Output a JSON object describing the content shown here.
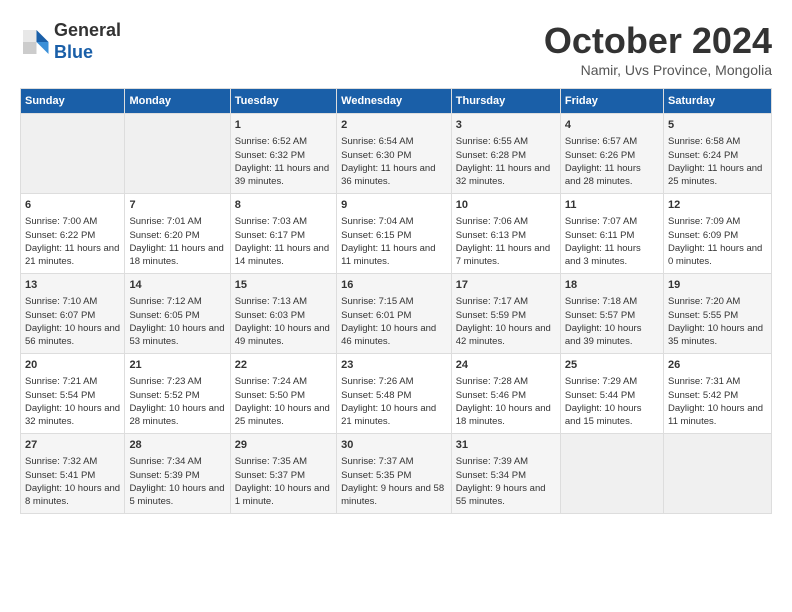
{
  "header": {
    "logo_line1": "General",
    "logo_line2": "Blue",
    "month_title": "October 2024",
    "location": "Namir, Uvs Province, Mongolia"
  },
  "weekdays": [
    "Sunday",
    "Monday",
    "Tuesday",
    "Wednesday",
    "Thursday",
    "Friday",
    "Saturday"
  ],
  "weeks": [
    [
      {
        "day": "",
        "info": ""
      },
      {
        "day": "",
        "info": ""
      },
      {
        "day": "1",
        "info": "Sunrise: 6:52 AM\nSunset: 6:32 PM\nDaylight: 11 hours and 39 minutes."
      },
      {
        "day": "2",
        "info": "Sunrise: 6:54 AM\nSunset: 6:30 PM\nDaylight: 11 hours and 36 minutes."
      },
      {
        "day": "3",
        "info": "Sunrise: 6:55 AM\nSunset: 6:28 PM\nDaylight: 11 hours and 32 minutes."
      },
      {
        "day": "4",
        "info": "Sunrise: 6:57 AM\nSunset: 6:26 PM\nDaylight: 11 hours and 28 minutes."
      },
      {
        "day": "5",
        "info": "Sunrise: 6:58 AM\nSunset: 6:24 PM\nDaylight: 11 hours and 25 minutes."
      }
    ],
    [
      {
        "day": "6",
        "info": "Sunrise: 7:00 AM\nSunset: 6:22 PM\nDaylight: 11 hours and 21 minutes."
      },
      {
        "day": "7",
        "info": "Sunrise: 7:01 AM\nSunset: 6:20 PM\nDaylight: 11 hours and 18 minutes."
      },
      {
        "day": "8",
        "info": "Sunrise: 7:03 AM\nSunset: 6:17 PM\nDaylight: 11 hours and 14 minutes."
      },
      {
        "day": "9",
        "info": "Sunrise: 7:04 AM\nSunset: 6:15 PM\nDaylight: 11 hours and 11 minutes."
      },
      {
        "day": "10",
        "info": "Sunrise: 7:06 AM\nSunset: 6:13 PM\nDaylight: 11 hours and 7 minutes."
      },
      {
        "day": "11",
        "info": "Sunrise: 7:07 AM\nSunset: 6:11 PM\nDaylight: 11 hours and 3 minutes."
      },
      {
        "day": "12",
        "info": "Sunrise: 7:09 AM\nSunset: 6:09 PM\nDaylight: 11 hours and 0 minutes."
      }
    ],
    [
      {
        "day": "13",
        "info": "Sunrise: 7:10 AM\nSunset: 6:07 PM\nDaylight: 10 hours and 56 minutes."
      },
      {
        "day": "14",
        "info": "Sunrise: 7:12 AM\nSunset: 6:05 PM\nDaylight: 10 hours and 53 minutes."
      },
      {
        "day": "15",
        "info": "Sunrise: 7:13 AM\nSunset: 6:03 PM\nDaylight: 10 hours and 49 minutes."
      },
      {
        "day": "16",
        "info": "Sunrise: 7:15 AM\nSunset: 6:01 PM\nDaylight: 10 hours and 46 minutes."
      },
      {
        "day": "17",
        "info": "Sunrise: 7:17 AM\nSunset: 5:59 PM\nDaylight: 10 hours and 42 minutes."
      },
      {
        "day": "18",
        "info": "Sunrise: 7:18 AM\nSunset: 5:57 PM\nDaylight: 10 hours and 39 minutes."
      },
      {
        "day": "19",
        "info": "Sunrise: 7:20 AM\nSunset: 5:55 PM\nDaylight: 10 hours and 35 minutes."
      }
    ],
    [
      {
        "day": "20",
        "info": "Sunrise: 7:21 AM\nSunset: 5:54 PM\nDaylight: 10 hours and 32 minutes."
      },
      {
        "day": "21",
        "info": "Sunrise: 7:23 AM\nSunset: 5:52 PM\nDaylight: 10 hours and 28 minutes."
      },
      {
        "day": "22",
        "info": "Sunrise: 7:24 AM\nSunset: 5:50 PM\nDaylight: 10 hours and 25 minutes."
      },
      {
        "day": "23",
        "info": "Sunrise: 7:26 AM\nSunset: 5:48 PM\nDaylight: 10 hours and 21 minutes."
      },
      {
        "day": "24",
        "info": "Sunrise: 7:28 AM\nSunset: 5:46 PM\nDaylight: 10 hours and 18 minutes."
      },
      {
        "day": "25",
        "info": "Sunrise: 7:29 AM\nSunset: 5:44 PM\nDaylight: 10 hours and 15 minutes."
      },
      {
        "day": "26",
        "info": "Sunrise: 7:31 AM\nSunset: 5:42 PM\nDaylight: 10 hours and 11 minutes."
      }
    ],
    [
      {
        "day": "27",
        "info": "Sunrise: 7:32 AM\nSunset: 5:41 PM\nDaylight: 10 hours and 8 minutes."
      },
      {
        "day": "28",
        "info": "Sunrise: 7:34 AM\nSunset: 5:39 PM\nDaylight: 10 hours and 5 minutes."
      },
      {
        "day": "29",
        "info": "Sunrise: 7:35 AM\nSunset: 5:37 PM\nDaylight: 10 hours and 1 minute."
      },
      {
        "day": "30",
        "info": "Sunrise: 7:37 AM\nSunset: 5:35 PM\nDaylight: 9 hours and 58 minutes."
      },
      {
        "day": "31",
        "info": "Sunrise: 7:39 AM\nSunset: 5:34 PM\nDaylight: 9 hours and 55 minutes."
      },
      {
        "day": "",
        "info": ""
      },
      {
        "day": "",
        "info": ""
      }
    ]
  ]
}
